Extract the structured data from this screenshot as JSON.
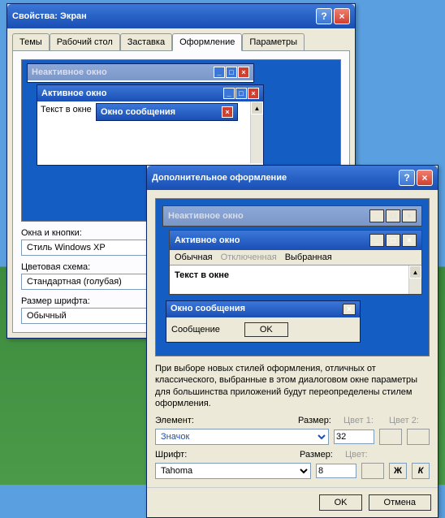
{
  "main_dialog": {
    "title": "Свойства: Экран",
    "tabs": [
      "Темы",
      "Рабочий стол",
      "Заставка",
      "Оформление",
      "Параметры"
    ],
    "active_tab": 3,
    "preview": {
      "inactive_title": "Неактивное окно",
      "active_title": "Активное окно",
      "window_text": "Текст в окне",
      "msg_title": "Окно сообщения"
    },
    "fields": {
      "windows_buttons_label": "Окна и кнопки:",
      "windows_buttons_value": "Стиль Windows XP",
      "color_scheme_label": "Цветовая схема:",
      "color_scheme_value": "Стандартная (голубая)",
      "font_size_label": "Размер шрифта:",
      "font_size_value": "Обычный"
    }
  },
  "adv_dialog": {
    "title": "Дополнительное оформление",
    "preview": {
      "inactive_title": "Неактивное окно",
      "active_title": "Активное окно",
      "menu_normal": "Обычная",
      "menu_disabled": "Отключенная",
      "menu_selected": "Выбранная",
      "window_text": "Текст в окне",
      "msg_title": "Окно сообщения",
      "msg_text": "Сообщение",
      "msg_ok": "OK"
    },
    "note": "При выборе новых стилей оформления, отличных от классического, выбранные в этом диалоговом окне параметры для большинства приложений будут переопределены стилем оформления.",
    "element_label": "Элемент:",
    "element_value": "Значок",
    "size_label": "Размер:",
    "size_value": "32",
    "color1_label": "Цвет 1:",
    "color2_label": "Цвет 2:",
    "font_label": "Шрифт:",
    "font_value": "Tahoma",
    "font_size_label": "Размер:",
    "font_size_value": "8",
    "font_color_label": "Цвет:",
    "bold": "Ж",
    "italic": "К",
    "ok": "OK",
    "cancel": "Отмена"
  }
}
